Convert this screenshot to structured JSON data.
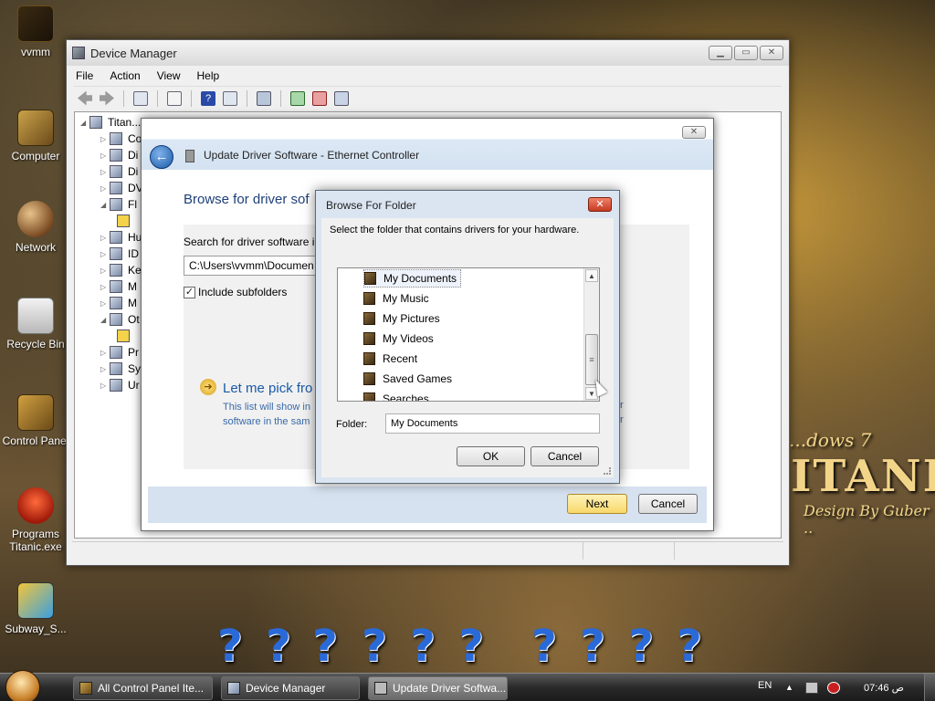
{
  "desktop": {
    "icons": [
      {
        "label": "vvmm"
      },
      {
        "label": "Computer"
      },
      {
        "label": "Network"
      },
      {
        "label": "Recycle Bin"
      },
      {
        "label": "Control Panel"
      },
      {
        "label": "Programs Titanic.exe"
      },
      {
        "label": "Subway_S..."
      }
    ],
    "brand_top": "...dows 7",
    "brand_main": "ITANI",
    "brand_sub": "Design By Guber .."
  },
  "device_manager": {
    "title": "Device Manager",
    "menu": [
      "File",
      "Action",
      "View",
      "Help"
    ],
    "tree_root": "Titan...",
    "tree_items": [
      "Co",
      "Di",
      "Di",
      "DV",
      "Fl",
      "",
      "Hu",
      "ID",
      "Ke",
      "M",
      "M",
      "Ot",
      "",
      "Pr",
      "Sy",
      "Ur"
    ]
  },
  "update_driver": {
    "title": "Update Driver Software - Ethernet Controller",
    "heading": "Browse for driver sof",
    "search_label": "Search for driver software in",
    "path_value": "C:\\Users\\vvmm\\Documen",
    "include_subfolders": "Include subfolders",
    "pick_link": "Let me pick fro",
    "pick_desc_1": "This list will show in",
    "pick_desc_2": "software in the sam",
    "pick_desc_right_1": "r",
    "pick_desc_right_2": "r",
    "next_label": "Next",
    "cancel_label": "Cancel"
  },
  "browse_folder": {
    "title": "Browse For Folder",
    "description": "Select the folder that contains drivers for your hardware.",
    "folders": [
      "My Documents",
      "My Music",
      "My Pictures",
      "My Videos",
      "Recent",
      "Saved Games",
      "Searches"
    ],
    "selected_folder": "My Documents",
    "folder_label": "Folder:",
    "folder_value": "My Documents",
    "ok_label": "OK",
    "cancel_label": "Cancel"
  },
  "taskbar": {
    "tasks": [
      "All Control Panel Ite...",
      "Device Manager",
      "Update Driver Softwa..."
    ],
    "language": "EN",
    "clock": "07:46 ص"
  },
  "colors": {
    "link_blue": "#1a5aa8",
    "heading_blue": "#1e3f7a",
    "default_button": "#f7d86a",
    "help_icon_blue": "#2a6ad8"
  }
}
